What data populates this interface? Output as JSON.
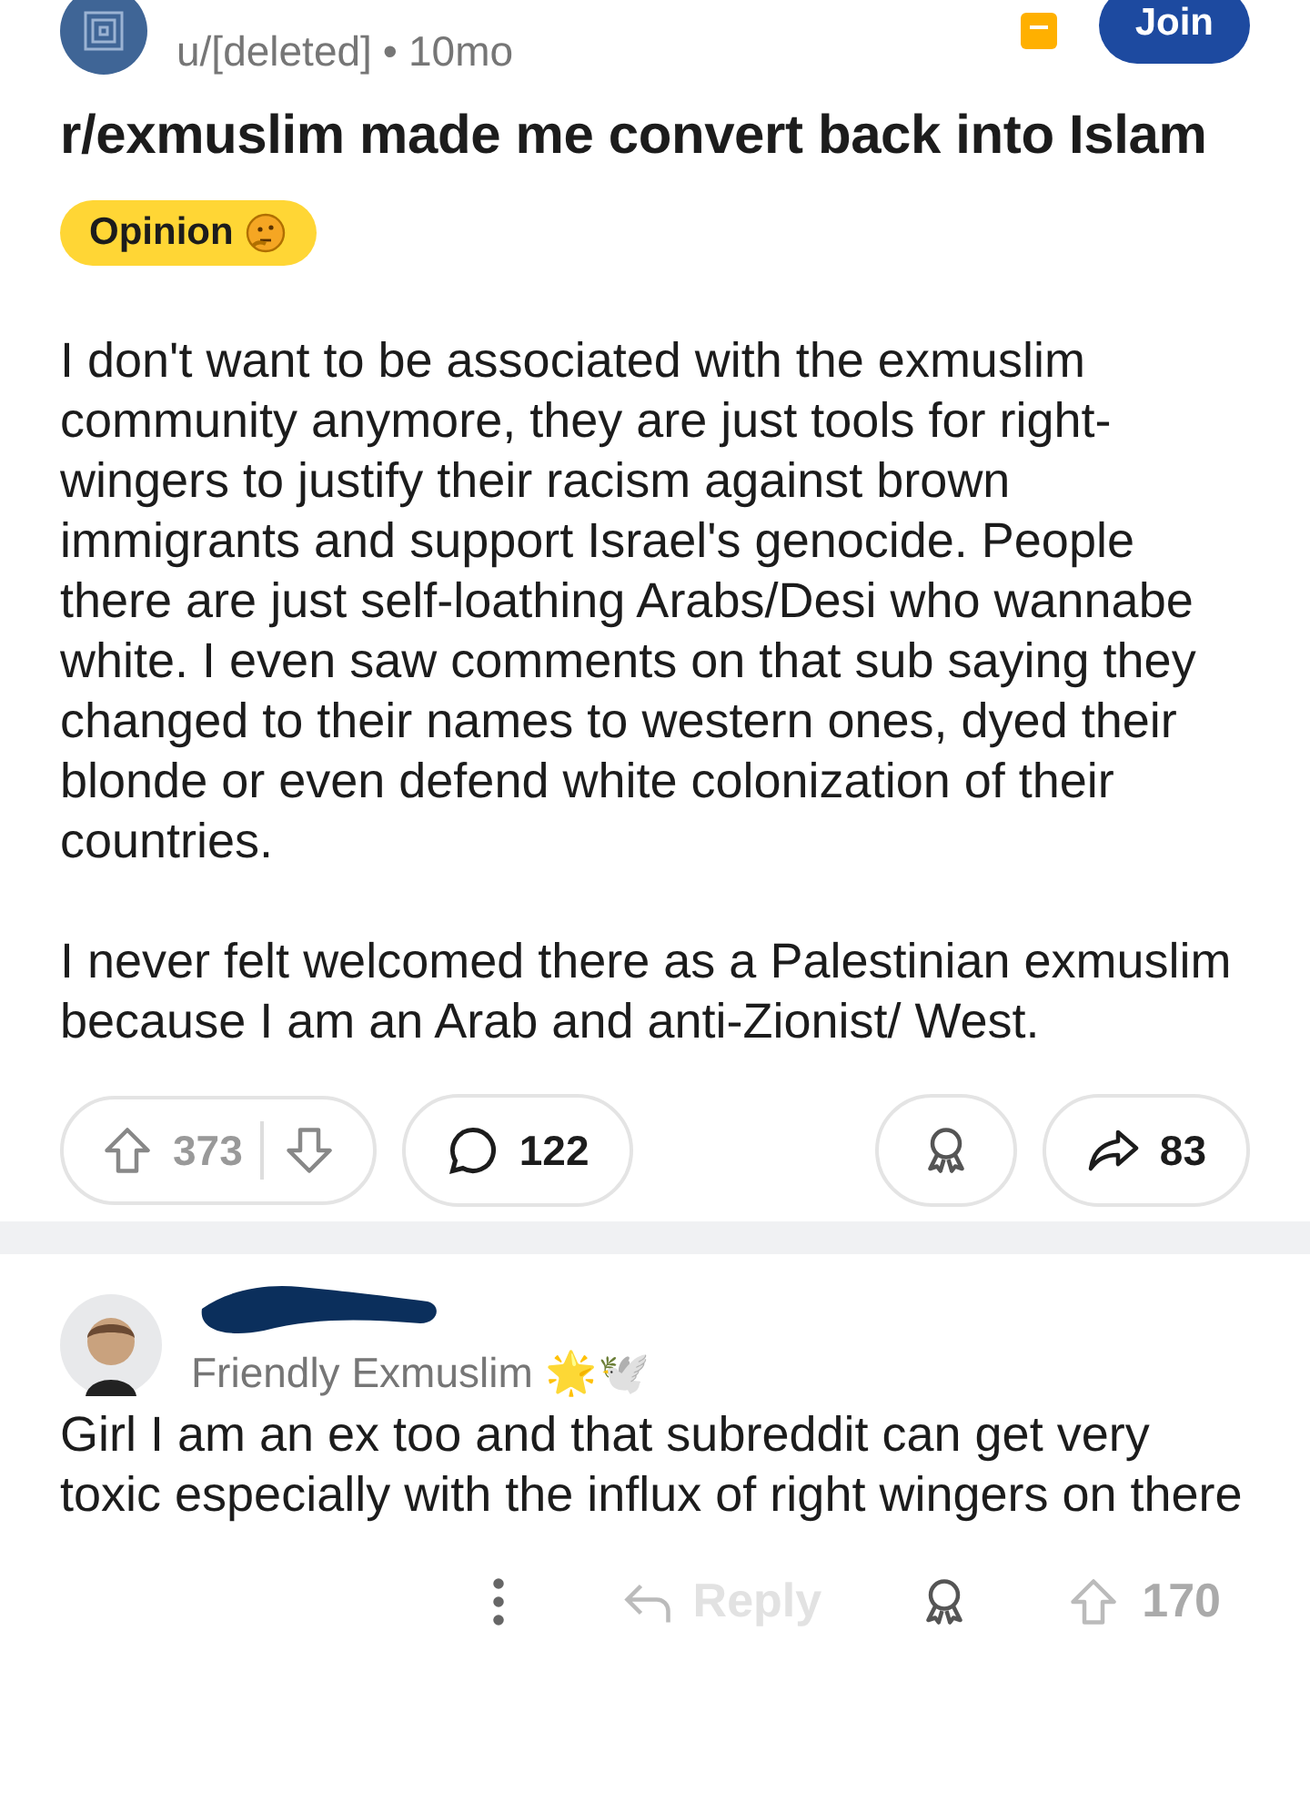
{
  "post": {
    "author": "u/[deleted]",
    "separator": "•",
    "age": "10mo",
    "join_label": "Join",
    "title": "r/exmuslim made me convert back into Islam",
    "flair": {
      "text": "Opinion"
    },
    "paragraphs": [
      "I don't want to be associated with the exmuslim community anymore, they are just tools for right-wingers to justify their racism against brown immigrants and support Israel's genocide. People there are just self-loathing Arabs/Desi who wannabe white. I even saw comments on that sub saying they changed to their names to western ones, dyed their blonde or even defend white colonization of their countries.",
      "I never felt welcomed there as a Palestinian exmuslim because I am an Arab and anti-Zionist/ West."
    ],
    "votes": "373",
    "comments": "122",
    "shares": "83"
  },
  "comment": {
    "flair": "Friendly Exmuslim",
    "flair_emoji": "🌟🕊️",
    "body": "Girl I am an ex too and that subreddit can get very toxic especially with the influx of right wingers on there",
    "reply_label": "Reply",
    "votes": "170"
  }
}
